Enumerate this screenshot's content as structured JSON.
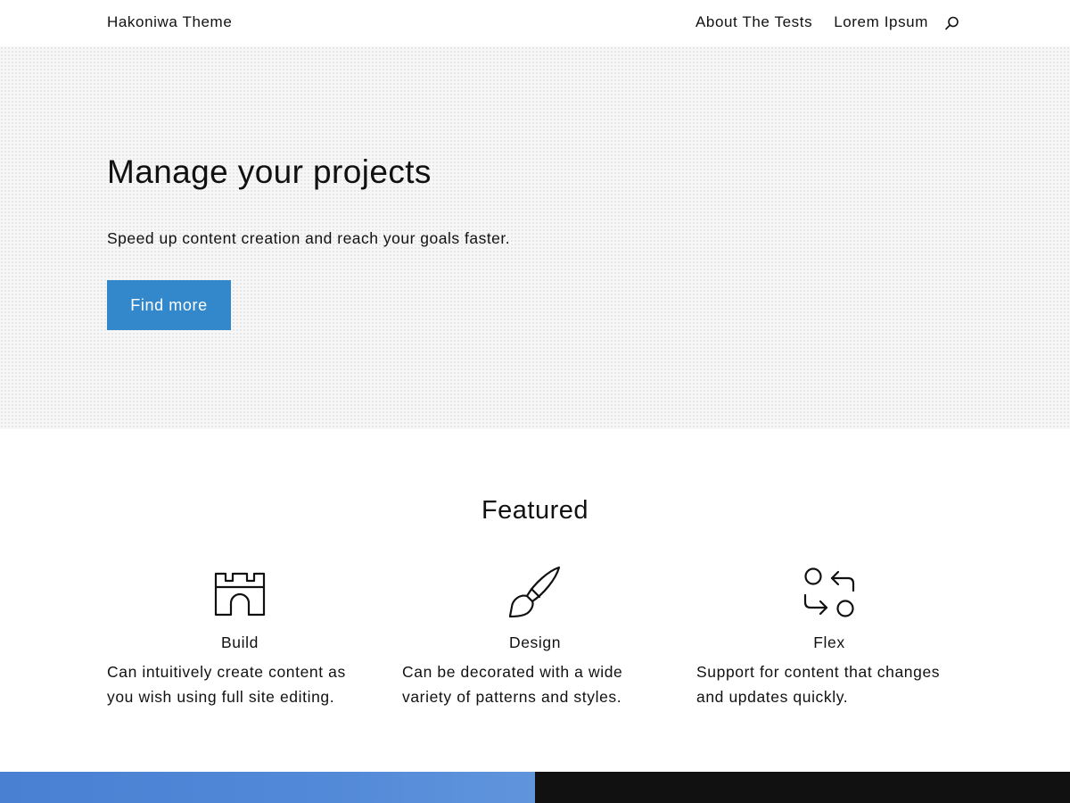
{
  "header": {
    "site_title": "Hakoniwa Theme",
    "nav": {
      "items": [
        {
          "label": "About The Tests"
        },
        {
          "label": "Lorem Ipsum"
        }
      ],
      "search_icon": "search-icon"
    }
  },
  "hero": {
    "title": "Manage your projects",
    "text": "Speed up content creation and reach your goals faster.",
    "button_label": "Find more",
    "button_color": "#3388cc",
    "background_color": "#f7f7f7"
  },
  "featured": {
    "heading": "Featured",
    "items": [
      {
        "icon": "castle-icon",
        "title": "Build",
        "description": "Can intuitively create content as you wish using full site editing."
      },
      {
        "icon": "paintbrush-icon",
        "title": "Design",
        "description": "Can be decorated with a wide variety of patterns and styles."
      },
      {
        "icon": "flex-arrows-icon",
        "title": "Flex",
        "description": "Support for content that changes and updates quickly."
      }
    ]
  },
  "footer_bands": {
    "left_color": "#4a80d2",
    "right_color": "#111111"
  }
}
